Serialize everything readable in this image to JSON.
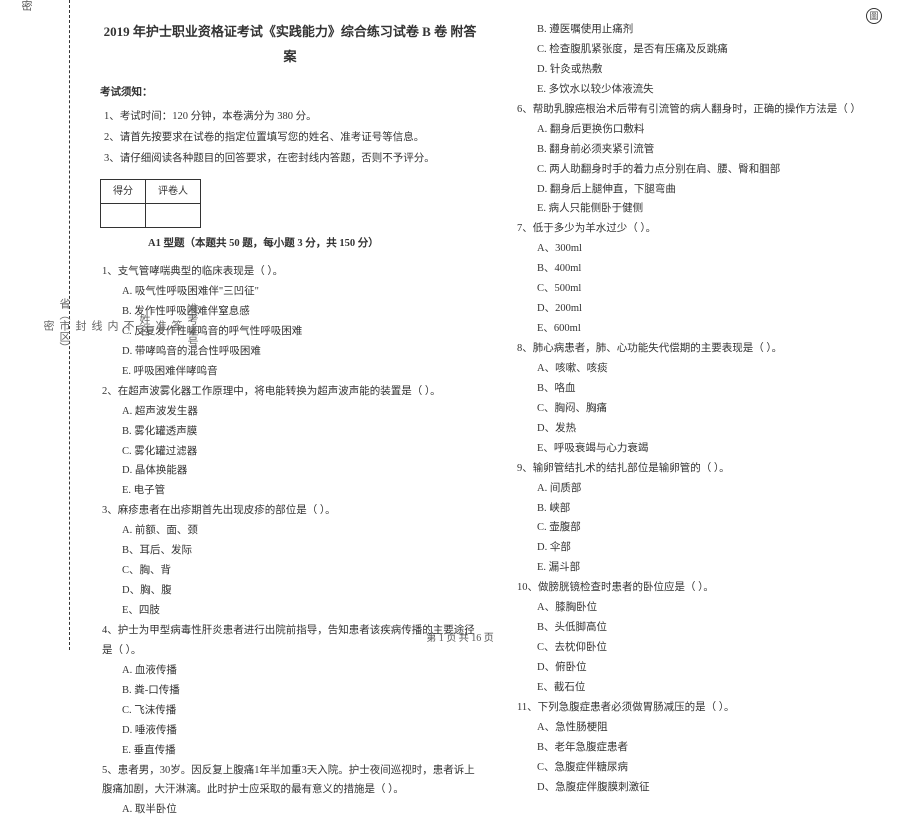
{
  "corner_mark": "圖",
  "binding": {
    "labels": [
      "省（市区）",
      "姓名",
      "准考证号"
    ],
    "inner": [
      "密",
      "封",
      "线",
      "内",
      "不",
      "准",
      "答"
    ]
  },
  "header": {
    "title": "2019 年护士职业资格证考试《实践能力》综合练习试卷 B 卷 附答案",
    "instructions_label": "考试须知：",
    "instructions": [
      "1、考试时间：120 分钟，本卷满分为 380 分。",
      "2、请首先按要求在试卷的指定位置填写您的姓名、准考证号等信息。",
      "3、请仔细阅读各种题目的回答要求，在密封线内答题，否则不予评分。"
    ],
    "score_headers": [
      "得分",
      "评卷人"
    ],
    "section_title": "A1 型题（本题共 50 题，每小题 3 分，共 150 分）"
  },
  "col1": [
    {
      "q": "1、支气管哮喘典型的临床表现是（    ）。",
      "opts": [
        "A. 吸气性呼吸困难伴\"三凹征\"",
        "B. 发作性呼吸困难伴窒息感",
        "C. 反复发作性哮鸣音的呼气性呼吸困难",
        "D. 带哮鸣音的混合性呼吸困难",
        "E. 呼吸困难伴哮鸣音"
      ]
    },
    {
      "q": "2、在超声波雾化器工作原理中，将电能转换为超声波声能的装置是（    ）。",
      "opts": [
        "A. 超声波发生器",
        "B. 雾化罐透声膜",
        "C. 雾化罐过滤器",
        "D. 晶体换能器",
        "E. 电子管"
      ]
    },
    {
      "q": "3、麻疹患者在出疹期首先出现皮疹的部位是（    ）。",
      "opts": [
        "A. 前额、面、颈",
        "B、耳后、发际",
        "C、胸、背",
        "D、胸、腹",
        "E、四肢"
      ]
    },
    {
      "q": "4、护士为甲型病毒性肝炎患者进行出院前指导，告知患者该疾病传播的主要途径是（    ）。",
      "opts": [
        "A. 血液传播",
        "B. 粪-口传播",
        "C. 飞沫传播",
        "D. 唾液传播",
        "E. 垂直传播"
      ]
    },
    {
      "q": "5、患者男，30岁。因反复上腹痛1年半加重3天入院。护士夜间巡视时，患者诉上腹痛加剧，大汗淋漓。此时护士应采取的最有意义的措施是（    ）。",
      "opts": [
        "A. 取半卧位"
      ]
    }
  ],
  "col2_continue": [
    "B. 遵医嘱使用止痛剂",
    "C. 检查腹肌紧张度，是否有压痛及反跳痛",
    "D. 针灸或热敷",
    "E. 多饮水以较少体液流失"
  ],
  "col2": [
    {
      "q": "6、帮助乳腺癌根治术后带有引流管的病人翻身时，正确的操作方法是（    ）",
      "opts": [
        "A. 翻身后更换伤口敷料",
        "B. 翻身前必须夹紧引流管",
        "C. 两人助翻身时手的着力点分别在肩、腰、臀和腘部",
        "D. 翻身后上腿伸直，下腿弯曲",
        "E. 病人只能侧卧于健侧"
      ]
    },
    {
      "q": "7、低于多少为羊水过少（    ）。",
      "opts": [
        "A、300ml",
        "B、400ml",
        "C、500ml",
        "D、200ml",
        "E、600ml"
      ]
    },
    {
      "q": "8、肺心病患者，肺、心功能失代偿期的主要表现是（    ）。",
      "opts": [
        "A、咳嗽、咳痰",
        "B、咯血",
        "C、胸闷、胸痛",
        "D、发热",
        "E、呼吸衰竭与心力衰竭"
      ]
    },
    {
      "q": "9、输卵管结扎术的结扎部位是输卵管的（    ）。",
      "opts": [
        "A. 间质部",
        "B. 峡部",
        "C. 壶腹部",
        "D. 伞部",
        "E. 漏斗部"
      ]
    },
    {
      "q": "10、做膀胱镜检查时患者的卧位应是（    ）。",
      "opts": [
        "A、膝胸卧位",
        "B、头低脚高位",
        "C、去枕仰卧位",
        "D、俯卧位",
        "E、截石位"
      ]
    },
    {
      "q": "11、下列急腹症患者必须做胃肠减压的是（    ）。",
      "opts": [
        "A、急性肠梗阻",
        "B、老年急腹症患者",
        "C、急腹症伴糖尿病",
        "D、急腹症伴腹膜刺激征"
      ]
    }
  ],
  "footer": "第 1 页 共 16 页"
}
